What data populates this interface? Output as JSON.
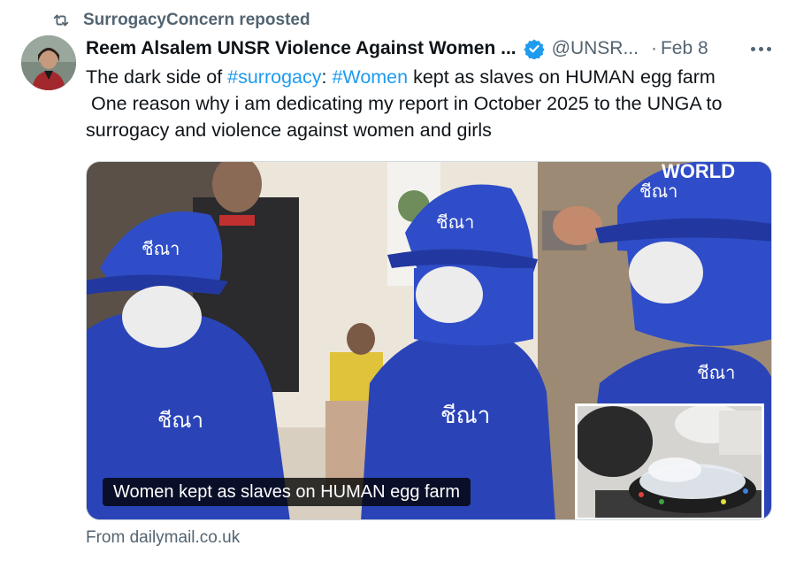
{
  "repost": {
    "label": "SurrogacyConcern reposted",
    "icon": "repost-icon"
  },
  "author": {
    "name": "Reem Alsalem UNSR Violence Against Women ...",
    "verified_icon": "verified-badge-icon",
    "handle": "@UNSR...",
    "separator": "·",
    "date": "Feb 8"
  },
  "more_icon": "more-options-icon",
  "tweet": {
    "line1_pre": "The dark side of ",
    "hashtag1": "#surrogacy",
    "line1_mid": ": ",
    "hashtag2": "#Women",
    "line1_post": " kept as slaves on HUMAN egg farm",
    "line2": " One reason why i am dedicating my report in October 2025 to the UNGA to",
    "line3": "surrogacy and violence against women and girls"
  },
  "card": {
    "caption": "Women kept as slaves on HUMAN egg farm",
    "watermark": "WORLD",
    "source": "From dailymail.co.uk"
  },
  "colors": {
    "link": "#1d9bf0",
    "secondary_text": "#536471",
    "verified": "#1d9bf0",
    "jacket_blue": "#2a44b8"
  }
}
